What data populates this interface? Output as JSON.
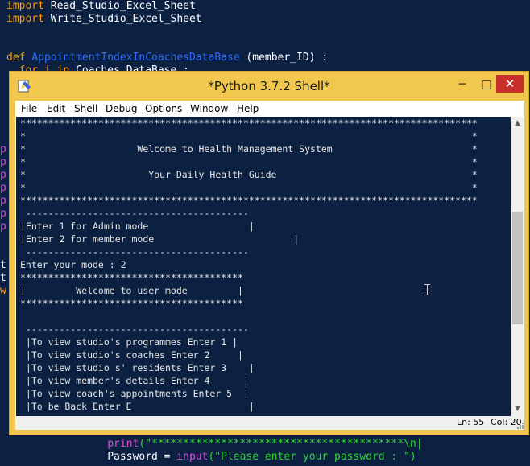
{
  "editor": {
    "lines": {
      "l1": {
        "kw": "import",
        "rest": " Read_Studio_Excel_Sheet"
      },
      "l2": {
        "kw": "import",
        "rest": " Write_Studio_Excel_Sheet"
      },
      "l3": {
        "kw": "def",
        "fn": " AppointmentIndexInCoachesDataBase",
        "rest": " (member_ID) :"
      },
      "l4": {
        "kw": "  for i in",
        "rest": " Coaches_DataBase :"
      },
      "print_line": {
        "indent": "                ",
        "bi": "print",
        "str": "(\"****************************************\\n|"
      },
      "password_line": {
        "indent": "                ",
        "rest": "Password = ",
        "bi": "input",
        "str": "(\"Please enter your password : \")"
      }
    },
    "gutter": [
      "p",
      "p",
      "p",
      "p",
      "p",
      "p",
      "p"
    ],
    "gutter_t": [
      "t",
      "t",
      "w"
    ]
  },
  "window": {
    "title": "*Python 3.7.2 Shell*",
    "minimize": "─",
    "maximize": "□",
    "close": "✕"
  },
  "menu": {
    "file": {
      "u": "F",
      "rest": "ile"
    },
    "edit": {
      "u": "E",
      "rest": "dit"
    },
    "shell": {
      "pre": "She",
      "u": "l",
      "rest": "l"
    },
    "debug": {
      "u": "D",
      "rest": "ebug"
    },
    "options": {
      "u": "O",
      "rest": "ptions"
    },
    "window": {
      "u": "W",
      "rest": "indow"
    },
    "help": {
      "u": "H",
      "rest": "elp"
    }
  },
  "console": {
    "lines": [
      "**********************************************************************************",
      "*                                                                                *",
      "*                    Welcome to Health Management System                         *",
      "*                                                                                *",
      "*                      Your Daily Health Guide                                   *",
      "*                                                                                *",
      "**********************************************************************************",
      " ----------------------------------------",
      "|Enter 1 for Admin mode                  |",
      "|Enter 2 for member mode                         |",
      " ----------------------------------------",
      "Enter your mode : 2",
      "****************************************",
      "|         Welcome to user mode         |",
      "****************************************",
      "",
      " ----------------------------------------",
      " |To view studio's programmes Enter 1 |",
      " |To view studio's coaches Enter 2     |",
      " |To view studio s' residents Enter 3    |",
      " |To view member's details Enter 4      |",
      " |To view coach's appointments Enter 5  |",
      " |To be Back Enter E                     |"
    ]
  },
  "scrollbar": {
    "up": "▲",
    "down": "▼"
  },
  "status": {
    "ln": "Ln: 55",
    "col": "Col: 20"
  },
  "colors": {
    "editor_bg": "#0c2142",
    "keyword": "#ff9d00",
    "function": "#2f6bff",
    "builtin": "#d74fd7",
    "string": "#2fd62f",
    "window_frame": "#f1c74d",
    "close_button": "#c9302c"
  },
  "icons": {
    "app": "python-idle-icon",
    "caret": "i-beam-cursor-icon",
    "grip": "resize-grip-icon"
  }
}
